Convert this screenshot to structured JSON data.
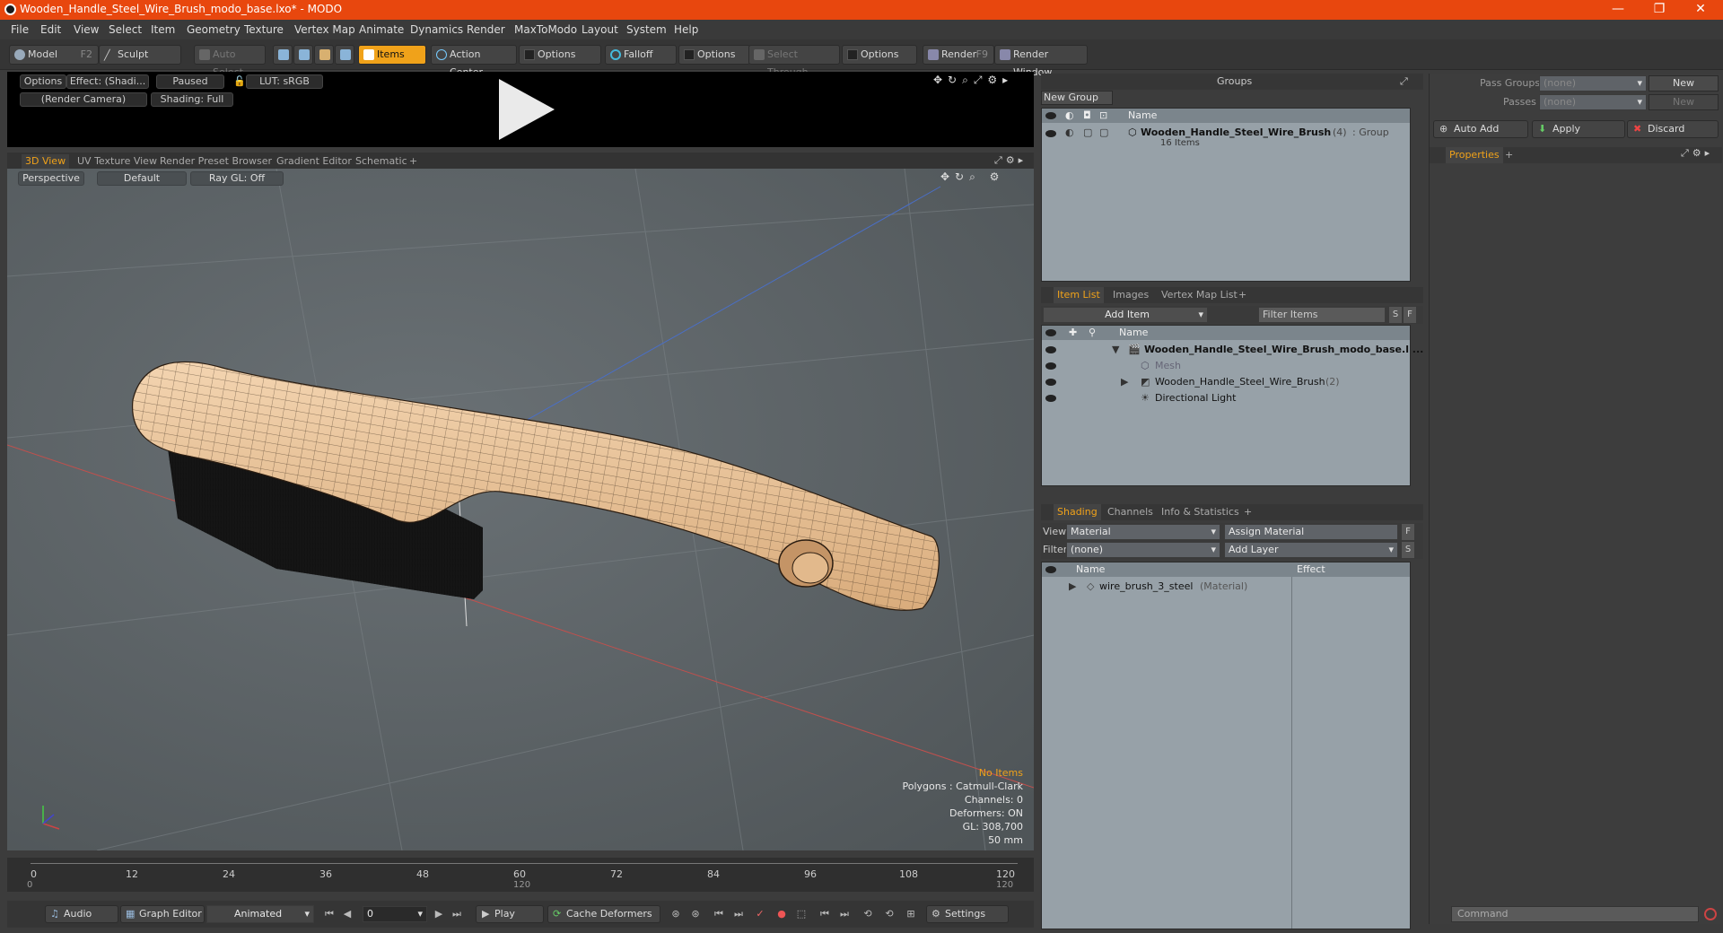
{
  "titlebar": {
    "title": "Wooden_Handle_Steel_Wire_Brush_modo_base.lxo* - MODO",
    "minimize": "—",
    "restore": "❐",
    "close": "✕"
  },
  "menu": [
    "File",
    "Edit",
    "View",
    "Select",
    "Item",
    "Geometry",
    "Texture",
    "Vertex Map",
    "Animate",
    "Dynamics",
    "Render",
    "MaxToModo",
    "Layout",
    "System",
    "Help"
  ],
  "toolbar": {
    "model": "Model",
    "model_key": "F2",
    "sculpt": "Sculpt",
    "auto_select": "Auto Select",
    "items": "Items",
    "action_center": "Action Center",
    "options1": "Options",
    "falloff": "Falloff",
    "options2": "Options",
    "select_through": "Select Through",
    "options3": "Options",
    "render": "Render",
    "render_key": "F9",
    "render_window": "Render Window"
  },
  "preview": {
    "options": "Options",
    "effect": "Effect: (Shadi...",
    "paused": "Paused",
    "lut": "LUT: sRGB",
    "camera": "(Render Camera)",
    "shading": "Shading: Full"
  },
  "viewtabs": [
    "3D View",
    "UV Texture View",
    "Render Preset Browser",
    "Gradient Editor",
    "Schematic",
    "+"
  ],
  "viewport": {
    "perspective": "Perspective",
    "default": "Default",
    "raygl": "Ray GL: Off",
    "stats": {
      "noitems": "No Items",
      "polygons": "Polygons : Catmull-Clark",
      "channels": "Channels: 0",
      "deformers": "Deformers: ON",
      "gl": "GL: 308,700",
      "mm": "50 mm"
    }
  },
  "timeline": {
    "ticks": [
      "0",
      "12",
      "24",
      "36",
      "48",
      "60",
      "72",
      "84",
      "96",
      "108",
      "120"
    ],
    "sub_start": "0",
    "sub_mid": "120",
    "sub_end": "120"
  },
  "bottombar": {
    "audio": "Audio",
    "graph_editor": "Graph Editor",
    "animated": "Animated",
    "frame": "0",
    "play": "Play",
    "cache_deformers": "Cache Deformers",
    "settings": "Settings"
  },
  "groups": {
    "title": "Groups",
    "new_group": "New Group",
    "col_name": "Name",
    "row_name": "Wooden_Handle_Steel_Wire_Brush",
    "row_count": "(4)",
    "row_type": ": Group",
    "row_items": "16 Items"
  },
  "itemlist": {
    "tabs": [
      "Item List",
      "Images",
      "Vertex Map List",
      "+"
    ],
    "add_item": "Add Item",
    "filter_items": "Filter Items",
    "s": "S",
    "f": "F",
    "col_name": "Name",
    "rows": [
      {
        "label": "Wooden_Handle_Steel_Wire_Brush_modo_base.l ...",
        "extra": ""
      },
      {
        "label": "Mesh",
        "extra": ""
      },
      {
        "label": "Wooden_Handle_Steel_Wire_Brush",
        "extra": "(2)"
      },
      {
        "label": "Directional Light",
        "extra": ""
      }
    ]
  },
  "shading": {
    "tabs": [
      "Shading",
      "Channels",
      "Info & Statistics",
      "+"
    ],
    "view_label": "View",
    "view_value": "Material",
    "assign_material": "Assign Material",
    "f": "F",
    "filter_label": "Filter",
    "filter_value": "(none)",
    "add_layer": "Add Layer",
    "s": "S",
    "col_name": "Name",
    "col_effect": "Effect",
    "row_name": "wire_brush_3_steel",
    "row_type": "(Material)"
  },
  "passes": {
    "pass_groups": "Pass Groups",
    "pass_groups_value": "(none)",
    "new1": "New",
    "passes": "Passes",
    "passes_value": "(none)",
    "new2": "New",
    "auto_add": "Auto Add",
    "apply": "Apply",
    "discard": "Discard",
    "properties": "Properties",
    "plus": "+",
    "command_placeholder": "Command"
  }
}
